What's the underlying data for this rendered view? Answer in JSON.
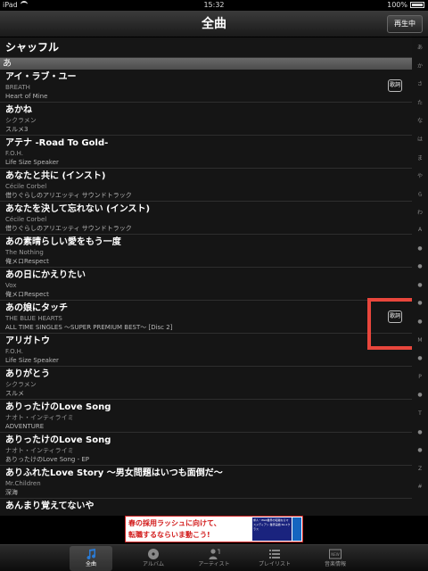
{
  "status": {
    "device": "iPad",
    "time": "15:32",
    "battery": "100%"
  },
  "nav": {
    "title": "全曲",
    "now_playing": "再生中"
  },
  "list": {
    "shuffle": "シャッフル",
    "section": "あ",
    "rows": [
      {
        "title": "アイ・ラブ・ユー",
        "artist": "BREATH",
        "album": "Heart of Mine",
        "lyrics": "歌詞"
      },
      {
        "title": "あかね",
        "artist": "シクラメン",
        "album": "スルメ3"
      },
      {
        "title": "アテナ -Road To Gold-",
        "artist": "F.O.H.",
        "album": "Life Size Speaker"
      },
      {
        "title": "あなたと共に (インスト)",
        "artist": "Cécile Corbel",
        "album": "借りぐらしのアリエッティ サウンドトラック"
      },
      {
        "title": "あなたを決して忘れない (インスト)",
        "artist": "Cécile Corbel",
        "album": "借りぐらしのアリエッティ サウンドトラック"
      },
      {
        "title": "あの素晴らしい愛をもう一度",
        "artist": "The Nothing",
        "album": "俺メロRespect"
      },
      {
        "title": "あの日にかえりたい",
        "artist": "Vox",
        "album": "俺メロRespect"
      },
      {
        "title": "あの娘にタッチ",
        "artist": "THE BLUE HEARTS",
        "album": "ALL TIME SINGLES ～SUPER PREMIUM BEST～ [Disc 2]",
        "lyrics": "歌詞"
      },
      {
        "title": "アリガトウ",
        "artist": "F.O.H.",
        "album": "Life Size Speaker"
      },
      {
        "title": "ありがとう",
        "artist": "シクラメン",
        "album": "スルメ"
      },
      {
        "title": "ありったけのLove Song",
        "artist": "ナオト・インティライミ",
        "album": "ADVENTURE"
      },
      {
        "title": "ありったけのLove Song",
        "artist": "ナオト・インティライミ",
        "album": "ありったけのLove Song - EP"
      },
      {
        "title": "ありふれたLove Story 〜男女問題はいつも面倒だ〜",
        "artist": "Mr.Children",
        "album": "深海"
      },
      {
        "title": "あんまり覚えてないや"
      }
    ]
  },
  "index": [
    "あ",
    "か",
    "さ",
    "た",
    "な",
    "は",
    "ま",
    "や",
    "ら",
    "わ",
    "A",
    "●",
    "●",
    "●",
    "●",
    "●",
    "M",
    "●",
    "P",
    "●",
    "T",
    "●",
    "●",
    "Z",
    "#"
  ],
  "ad": {
    "line1": "春の採用ラッシュに向けて、",
    "line2": "転職するならいま動こう!",
    "side_text": "求人・Web業界の転職ならマスメディアン 業界実績 No.1クラス",
    "vertical": "mediaan"
  },
  "tabs": [
    {
      "label": "全曲",
      "icon": "music-note-icon",
      "active": true
    },
    {
      "label": "アルバム",
      "icon": "album-disc-icon"
    },
    {
      "label": "アーティスト",
      "icon": "artist-icon"
    },
    {
      "label": "プレイリスト",
      "icon": "playlist-icon"
    },
    {
      "label": "音楽情報",
      "icon": "news-icon"
    }
  ],
  "colors": {
    "highlight": "#e8463c",
    "ad_red": "#d21a1a",
    "active_icon": "#2a7bd6"
  }
}
